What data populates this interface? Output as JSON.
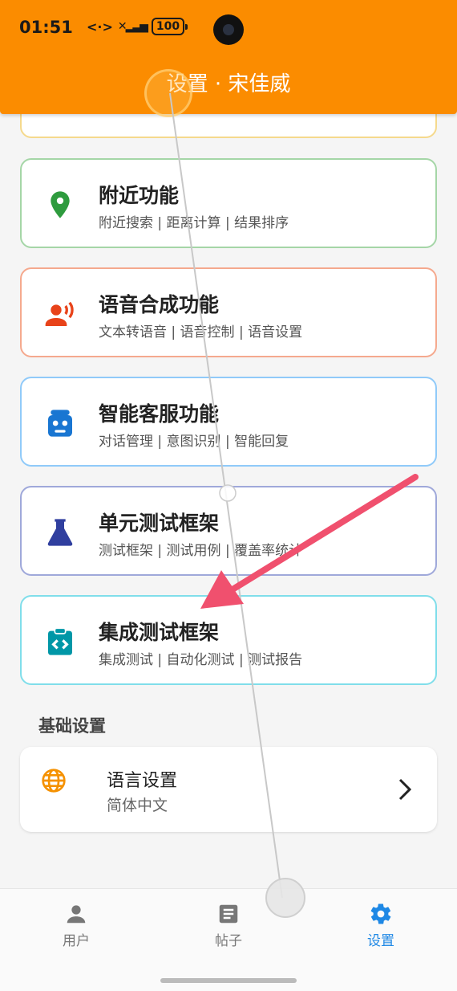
{
  "status_bar": {
    "time": "01:51",
    "network": "<·>",
    "battery": "100"
  },
  "header": {
    "title": "设置 · 宋佳威"
  },
  "cards": [
    {
      "title": "附近功能",
      "subtitle": "附近搜索 | 距离计算 | 结果排序",
      "icon": "location-pin-icon",
      "color": "#43a047"
    },
    {
      "title": "语音合成功能",
      "subtitle": "文本转语音 | 语音控制 | 语音设置",
      "icon": "speaker-person-icon",
      "color": "#f4511e"
    },
    {
      "title": "智能客服功能",
      "subtitle": "对话管理 | 意图识别 | 智能回复",
      "icon": "robot-icon",
      "color": "#1e88e5"
    },
    {
      "title": "单元测试框架",
      "subtitle": "测试框架 | 测试用例 | 覆盖率统计",
      "icon": "flask-icon",
      "color": "#3949ab"
    },
    {
      "title": "集成测试框架",
      "subtitle": "集成测试 | 自动化测试 | 测试报告",
      "icon": "code-clipboard-icon",
      "color": "#00acc1"
    }
  ],
  "basic_settings": {
    "section_title": "基础设置",
    "language": {
      "title": "语言设置",
      "value": "简体中文",
      "icon": "globe-icon"
    }
  },
  "bottom_nav": [
    {
      "label": "用户",
      "icon": "person-icon"
    },
    {
      "label": "帖子",
      "icon": "article-icon"
    },
    {
      "label": "设置",
      "icon": "gear-icon",
      "active": true
    }
  ],
  "colors": {
    "header": "#fb8c00",
    "active": "#1e88e5"
  }
}
